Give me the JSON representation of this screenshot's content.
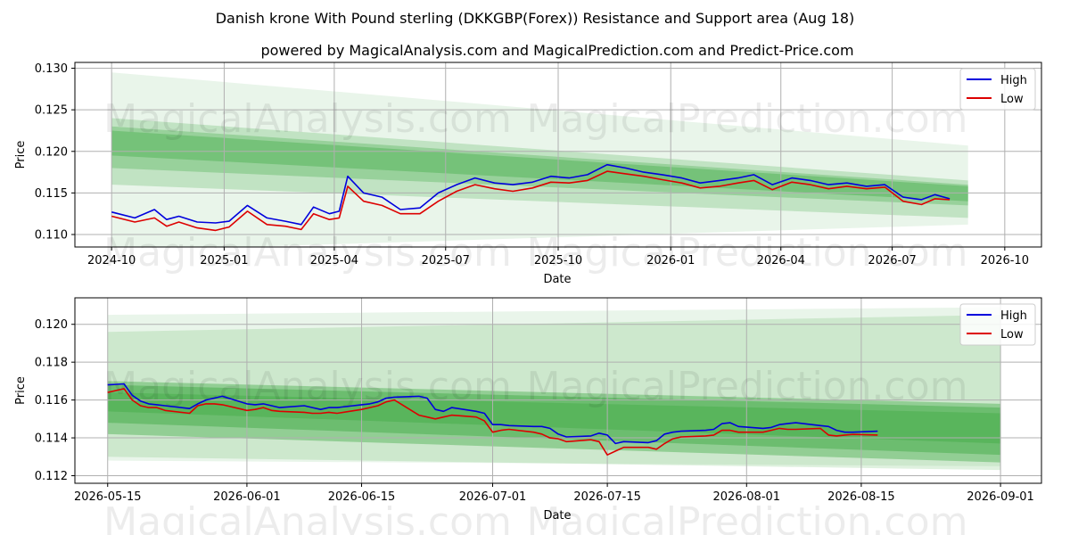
{
  "title": "Danish krone With Pound sterling (DKKGBP(Forex)) Resistance and Support area (Aug 18)",
  "subtitle": "powered by MagicalAnalysis.com and MagicalPrediction.com and Predict-Price.com",
  "watermark_left": "MagicalAnalysis.com",
  "watermark_right": "MagicalPrediction.com",
  "colors": {
    "high": "#0000dd",
    "low": "#dd0000",
    "band": "#4caf50",
    "grid": "#b0b0b0"
  },
  "chart_data": [
    {
      "type": "line",
      "xlabel": "Date",
      "ylabel": "Price",
      "x_ticks": [
        "2024-10",
        "2025-01",
        "2025-04",
        "2025-07",
        "2025-10",
        "2026-01",
        "2026-04",
        "2026-07",
        "2026-10"
      ],
      "y_ticks": [
        "0.110",
        "0.115",
        "0.120",
        "0.125",
        "0.130"
      ],
      "xlim": [
        "2024-09-01",
        "2026-10-31"
      ],
      "ylim": [
        0.1085,
        0.1307
      ],
      "legend": [
        "High",
        "Low"
      ],
      "legend_position": "top-right",
      "grid": true,
      "bands": [
        {
          "x": [
            "2024-10-01",
            "2026-09-01"
          ],
          "upper": [
            0.1295,
            0.1207
          ],
          "lower": [
            0.108,
            0.1112
          ],
          "opacity": 0.12
        },
        {
          "x": [
            "2024-10-01",
            "2026-09-01"
          ],
          "upper": [
            0.124,
            0.1165
          ],
          "lower": [
            0.116,
            0.112
          ],
          "opacity": 0.25
        },
        {
          "x": [
            "2024-10-01",
            "2026-09-01"
          ],
          "upper": [
            0.123,
            0.116
          ],
          "lower": [
            0.118,
            0.1135
          ],
          "opacity": 0.35
        },
        {
          "x": [
            "2024-10-01",
            "2026-09-01"
          ],
          "upper": [
            0.1225,
            0.1158
          ],
          "lower": [
            0.1195,
            0.114
          ],
          "opacity": 0.45
        }
      ],
      "series": [
        {
          "name": "High",
          "x": [
            "2024-10-01",
            "2024-10-20",
            "2024-11-05",
            "2024-11-15",
            "2024-11-25",
            "2024-12-10",
            "2024-12-25",
            "2025-01-05",
            "2025-01-20",
            "2025-02-05",
            "2025-02-20",
            "2025-03-05",
            "2025-03-15",
            "2025-03-28",
            "2025-04-05",
            "2025-04-12",
            "2025-04-25",
            "2025-05-10",
            "2025-05-25",
            "2025-06-10",
            "2025-06-25",
            "2025-07-10",
            "2025-07-25",
            "2025-08-10",
            "2025-08-25",
            "2025-09-10",
            "2025-09-25",
            "2025-10-10",
            "2025-10-25",
            "2025-11-10",
            "2025-11-25",
            "2025-12-10",
            "2025-12-25",
            "2026-01-10",
            "2026-01-25",
            "2026-02-10",
            "2026-02-25",
            "2026-03-10",
            "2026-03-25",
            "2026-04-10",
            "2026-04-25",
            "2026-05-10",
            "2026-05-25",
            "2026-06-10",
            "2026-06-25",
            "2026-07-10",
            "2026-07-25",
            "2026-08-05",
            "2026-08-17"
          ],
          "values": [
            0.1127,
            0.112,
            0.113,
            0.1118,
            0.1122,
            0.1115,
            0.1114,
            0.1116,
            0.1135,
            0.112,
            0.1116,
            0.1112,
            0.1133,
            0.1125,
            0.1128,
            0.117,
            0.115,
            0.1145,
            0.113,
            0.1132,
            0.115,
            0.116,
            0.1168,
            0.1162,
            0.116,
            0.1163,
            0.117,
            0.1168,
            0.1172,
            0.1184,
            0.118,
            0.1175,
            0.1172,
            0.1168,
            0.1162,
            0.1165,
            0.1168,
            0.1172,
            0.116,
            0.1168,
            0.1165,
            0.116,
            0.1162,
            0.1158,
            0.116,
            0.1145,
            0.1142,
            0.1148,
            0.1143
          ]
        },
        {
          "name": "Low",
          "x": [
            "2024-10-01",
            "2024-10-20",
            "2024-11-05",
            "2024-11-15",
            "2024-11-25",
            "2024-12-10",
            "2024-12-25",
            "2025-01-05",
            "2025-01-20",
            "2025-02-05",
            "2025-02-20",
            "2025-03-05",
            "2025-03-15",
            "2025-03-28",
            "2025-04-05",
            "2025-04-12",
            "2025-04-25",
            "2025-05-10",
            "2025-05-25",
            "2025-06-10",
            "2025-06-25",
            "2025-07-10",
            "2025-07-25",
            "2025-08-10",
            "2025-08-25",
            "2025-09-10",
            "2025-09-25",
            "2025-10-10",
            "2025-10-25",
            "2025-11-10",
            "2025-11-25",
            "2025-12-10",
            "2025-12-25",
            "2026-01-10",
            "2026-01-25",
            "2026-02-10",
            "2026-02-25",
            "2026-03-10",
            "2026-03-25",
            "2026-04-10",
            "2026-04-25",
            "2026-05-10",
            "2026-05-25",
            "2026-06-10",
            "2026-06-25",
            "2026-07-10",
            "2026-07-25",
            "2026-08-05",
            "2026-08-17"
          ],
          "values": [
            0.1122,
            0.1115,
            0.112,
            0.111,
            0.1115,
            0.1108,
            0.1105,
            0.1109,
            0.1128,
            0.1112,
            0.111,
            0.1106,
            0.1125,
            0.1118,
            0.112,
            0.1158,
            0.114,
            0.1135,
            0.1125,
            0.1125,
            0.114,
            0.1152,
            0.116,
            0.1155,
            0.1152,
            0.1156,
            0.1163,
            0.1162,
            0.1165,
            0.1176,
            0.1173,
            0.117,
            0.1166,
            0.1162,
            0.1156,
            0.1158,
            0.1162,
            0.1165,
            0.1154,
            0.1163,
            0.116,
            0.1155,
            0.1158,
            0.1155,
            0.1157,
            0.114,
            0.1136,
            0.1143,
            0.1142
          ]
        }
      ]
    },
    {
      "type": "line",
      "xlabel": "Date",
      "ylabel": "Price",
      "x_ticks": [
        "2026-05-15",
        "2026-06-01",
        "2026-06-15",
        "2026-07-01",
        "2026-07-15",
        "2026-08-01",
        "2026-08-15",
        "2026-09-01"
      ],
      "y_ticks": [
        "0.112",
        "0.114",
        "0.116",
        "0.118",
        "0.120"
      ],
      "xlim": [
        "2026-05-11",
        "2026-09-06"
      ],
      "ylim": [
        0.1116,
        0.1214
      ],
      "legend": [
        "High",
        "Low"
      ],
      "legend_position": "top-right",
      "grid": true,
      "bands": [
        {
          "x": [
            "2026-05-15",
            "2026-09-01"
          ],
          "upper": [
            0.1205,
            0.1209
          ],
          "lower": [
            0.1128,
            0.1125
          ],
          "opacity": 0.12
        },
        {
          "x": [
            "2026-05-15",
            "2026-09-01"
          ],
          "upper": [
            0.1196,
            0.1205
          ],
          "lower": [
            0.113,
            0.1123
          ],
          "opacity": 0.18
        },
        {
          "x": [
            "2026-05-15",
            "2026-09-01"
          ],
          "upper": [
            0.117,
            0.1158
          ],
          "lower": [
            0.1142,
            0.1127
          ],
          "opacity": 0.45
        },
        {
          "x": [
            "2026-05-15",
            "2026-09-01"
          ],
          "upper": [
            0.1168,
            0.1156
          ],
          "lower": [
            0.1148,
            0.1131
          ],
          "opacity": 0.55
        },
        {
          "x": [
            "2026-05-15",
            "2026-09-01"
          ],
          "upper": [
            0.1164,
            0.1153
          ],
          "lower": [
            0.1154,
            0.1137
          ],
          "opacity": 0.6
        }
      ],
      "series": [
        {
          "name": "High",
          "x": [
            "2026-05-15",
            "2026-05-17",
            "2026-05-18",
            "2026-05-19",
            "2026-05-20",
            "2026-05-21",
            "2026-05-22",
            "2026-05-25",
            "2026-05-26",
            "2026-05-27",
            "2026-05-28",
            "2026-05-29",
            "2026-06-01",
            "2026-06-02",
            "2026-06-03",
            "2026-06-04",
            "2026-06-05",
            "2026-06-08",
            "2026-06-09",
            "2026-06-10",
            "2026-06-11",
            "2026-06-12",
            "2026-06-15",
            "2026-06-16",
            "2026-06-17",
            "2026-06-18",
            "2026-06-19",
            "2026-06-22",
            "2026-06-23",
            "2026-06-24",
            "2026-06-25",
            "2026-06-26",
            "2026-06-29",
            "2026-06-30",
            "2026-07-01",
            "2026-07-02",
            "2026-07-03",
            "2026-07-06",
            "2026-07-07",
            "2026-07-08",
            "2026-07-09",
            "2026-07-10",
            "2026-07-13",
            "2026-07-14",
            "2026-07-15",
            "2026-07-16",
            "2026-07-17",
            "2026-07-20",
            "2026-07-21",
            "2026-07-22",
            "2026-07-23",
            "2026-07-24",
            "2026-07-27",
            "2026-07-28",
            "2026-07-29",
            "2026-07-30",
            "2026-07-31",
            "2026-08-03",
            "2026-08-04",
            "2026-08-05",
            "2026-08-06",
            "2026-08-07",
            "2026-08-10",
            "2026-08-11",
            "2026-08-12",
            "2026-08-13",
            "2026-08-14",
            "2026-08-17"
          ],
          "values": [
            0.1168,
            0.11685,
            0.11625,
            0.11595,
            0.1158,
            0.11575,
            0.1157,
            0.11555,
            0.1158,
            0.116,
            0.1161,
            0.1162,
            0.1158,
            0.11575,
            0.1158,
            0.1157,
            0.1156,
            0.1157,
            0.1156,
            0.1155,
            0.1156,
            0.1156,
            0.11575,
            0.1158,
            0.1159,
            0.1161,
            0.11615,
            0.1162,
            0.1161,
            0.1155,
            0.1154,
            0.1156,
            0.1154,
            0.1153,
            0.1147,
            0.1147,
            0.11465,
            0.1146,
            0.1146,
            0.1145,
            0.1142,
            0.11405,
            0.1141,
            0.11425,
            0.11415,
            0.1137,
            0.1138,
            0.11375,
            0.11385,
            0.1142,
            0.1143,
            0.11435,
            0.1144,
            0.11445,
            0.11475,
            0.1148,
            0.1146,
            0.1145,
            0.11455,
            0.1147,
            0.11475,
            0.1148,
            0.11465,
            0.1146,
            0.1144,
            0.1143,
            0.1143,
            0.11435
          ]
        },
        {
          "name": "Low",
          "x": [
            "2026-05-15",
            "2026-05-17",
            "2026-05-18",
            "2026-05-19",
            "2026-05-20",
            "2026-05-21",
            "2026-05-22",
            "2026-05-25",
            "2026-05-26",
            "2026-05-27",
            "2026-05-28",
            "2026-05-29",
            "2026-06-01",
            "2026-06-02",
            "2026-06-03",
            "2026-06-04",
            "2026-06-05",
            "2026-06-08",
            "2026-06-09",
            "2026-06-10",
            "2026-06-11",
            "2026-06-12",
            "2026-06-15",
            "2026-06-16",
            "2026-06-17",
            "2026-06-18",
            "2026-06-19",
            "2026-06-22",
            "2026-06-23",
            "2026-06-24",
            "2026-06-25",
            "2026-06-26",
            "2026-06-29",
            "2026-06-30",
            "2026-07-01",
            "2026-07-02",
            "2026-07-03",
            "2026-07-06",
            "2026-07-07",
            "2026-07-08",
            "2026-07-09",
            "2026-07-10",
            "2026-07-13",
            "2026-07-14",
            "2026-07-15",
            "2026-07-16",
            "2026-07-17",
            "2026-07-20",
            "2026-07-21",
            "2026-07-22",
            "2026-07-23",
            "2026-07-24",
            "2026-07-27",
            "2026-07-28",
            "2026-07-29",
            "2026-07-30",
            "2026-07-31",
            "2026-08-03",
            "2026-08-04",
            "2026-08-05",
            "2026-08-06",
            "2026-08-07",
            "2026-08-10",
            "2026-08-11",
            "2026-08-12",
            "2026-08-13",
            "2026-08-14",
            "2026-08-17"
          ],
          "values": [
            0.1164,
            0.1166,
            0.116,
            0.1157,
            0.1156,
            0.1156,
            0.11545,
            0.1153,
            0.1157,
            0.1158,
            0.1158,
            0.11575,
            0.11545,
            0.1155,
            0.1156,
            0.11545,
            0.1154,
            0.11535,
            0.1153,
            0.1153,
            0.11535,
            0.1153,
            0.1155,
            0.1156,
            0.1157,
            0.1159,
            0.116,
            0.1152,
            0.1151,
            0.115,
            0.1151,
            0.1152,
            0.1151,
            0.1149,
            0.1143,
            0.1144,
            0.11445,
            0.1143,
            0.1142,
            0.114,
            0.11395,
            0.1138,
            0.1139,
            0.1138,
            0.1131,
            0.1133,
            0.1135,
            0.1135,
            0.1134,
            0.1137,
            0.11395,
            0.11405,
            0.1141,
            0.11415,
            0.1144,
            0.1144,
            0.1143,
            0.1143,
            0.1144,
            0.1145,
            0.11445,
            0.11445,
            0.1145,
            0.11415,
            0.1141,
            0.11415,
            0.11418,
            0.11415
          ]
        }
      ]
    }
  ]
}
